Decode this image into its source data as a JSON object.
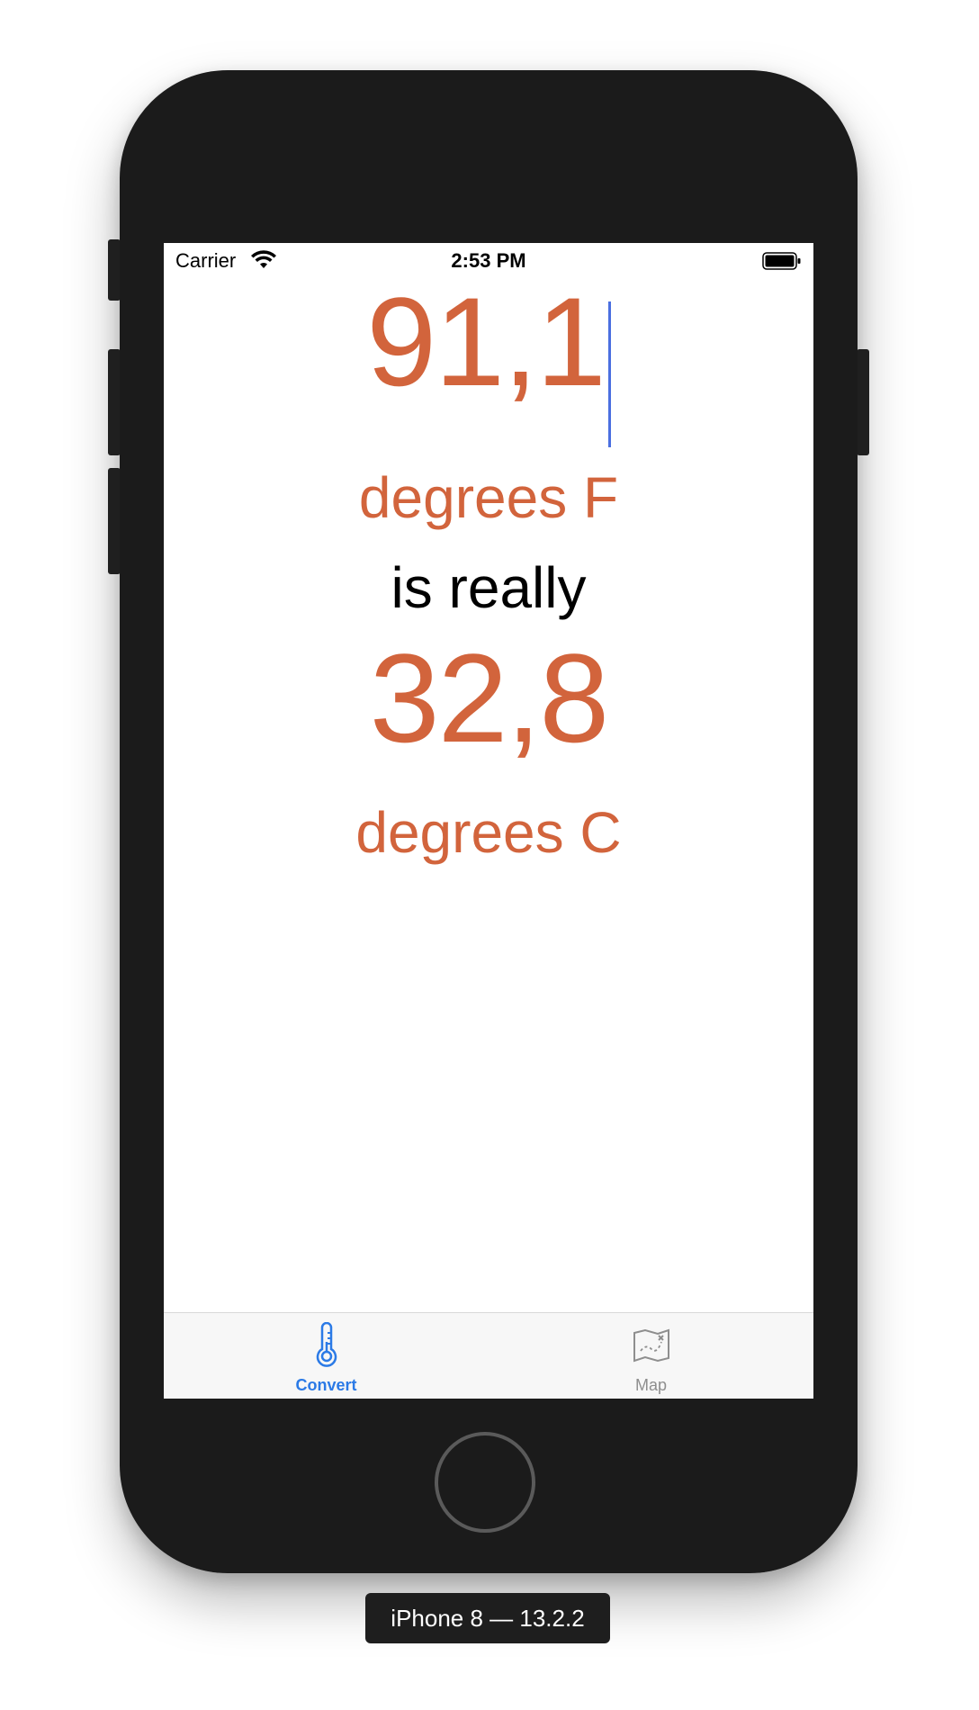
{
  "status_bar": {
    "carrier": "Carrier",
    "time": "2:53 PM"
  },
  "converter": {
    "fahrenheit_value": "91,1",
    "fahrenheit_unit": "degrees F",
    "connector": "is really",
    "celsius_value": "32,8",
    "celsius_unit": "degrees C"
  },
  "tab_bar": {
    "tabs": [
      {
        "label": "Convert",
        "icon": "thermometer-icon",
        "selected": true
      },
      {
        "label": "Map",
        "icon": "map-icon",
        "selected": false
      }
    ]
  },
  "device": {
    "label": "iPhone 8 — 13.2.2"
  },
  "colors": {
    "accent": "#D2643C",
    "tab_selected": "#2b7ae6",
    "tab_unselected": "#8e8e8e",
    "caret": "#4a6fe0"
  }
}
